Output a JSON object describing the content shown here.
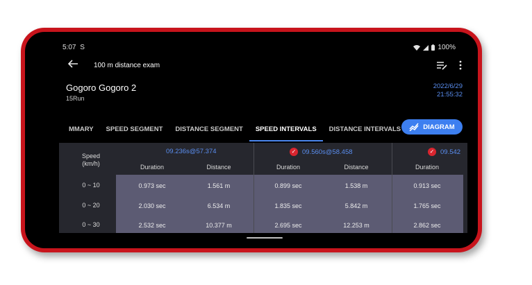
{
  "status": {
    "time": "5:07",
    "sync_glyph": "S",
    "battery": "100%"
  },
  "app_bar": {
    "title": "100 m distance exam"
  },
  "device": {
    "name": "Gogoro Gogoro 2",
    "subtitle": "15Run",
    "date": "2022/6/29",
    "time": "21:55:32"
  },
  "tabs": [
    {
      "label": "MMARY"
    },
    {
      "label": "SPEED SEGMENT"
    },
    {
      "label": "DISTANCE SEGMENT"
    },
    {
      "label": "SPEED INTERVALS",
      "active": true
    },
    {
      "label": "DISTANCE INTERVALS"
    }
  ],
  "diagram_button": {
    "label": "DIAGRAM",
    "icon": "chart-line-icon"
  },
  "table": {
    "speed_header": {
      "line1": "Speed",
      "line2": "(km/h)"
    },
    "intervals": [
      {
        "label": "09.236s@57.374",
        "checked": false
      },
      {
        "label": "09.560s@58.458",
        "checked": true
      },
      {
        "label": "09.542",
        "checked": true
      }
    ],
    "col_headers": {
      "duration": "Duration",
      "distance": "Distance"
    },
    "rows": [
      {
        "label": "0 ~ 10",
        "c1_dur": "0.973 sec",
        "c1_dist": "1.561 m",
        "c2_dur": "0.899 sec",
        "c2_dist": "1.538 m",
        "c3_dur": "0.913 sec"
      },
      {
        "label": "0 ~ 20",
        "c1_dur": "2.030 sec",
        "c1_dist": "6.534 m",
        "c2_dur": "1.835 sec",
        "c2_dist": "5.842 m",
        "c3_dur": "1.765 sec"
      },
      {
        "label": "0 ~ 30",
        "c1_dur": "2.532 sec",
        "c1_dist": "10.377 m",
        "c2_dur": "2.695 sec",
        "c2_dist": "12.253 m",
        "c3_dur": "2.862 sec"
      }
    ]
  },
  "colors": {
    "frame": "#c8141c",
    "accent": "#3d7ff0",
    "data_block": "#5c5b73",
    "check": "#d9252f"
  }
}
